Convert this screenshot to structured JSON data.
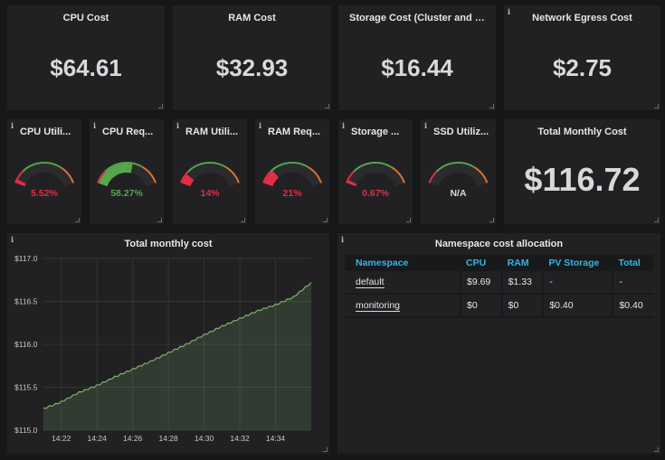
{
  "stats": {
    "cpu_cost": {
      "title": "CPU Cost",
      "value": "$64.61"
    },
    "ram_cost": {
      "title": "RAM Cost",
      "value": "$32.93"
    },
    "storage_cost": {
      "title": "Storage Cost (Cluster and PV...",
      "value": "$16.44"
    },
    "egress_cost": {
      "title": "Network Egress Cost",
      "value": "$2.75"
    },
    "total_monthly": {
      "title": "Total Monthly Cost",
      "value": "$116.72"
    }
  },
  "gauges": [
    {
      "title": "CPU Utili...",
      "value": "5.52%",
      "percent": 5.52,
      "color": "#e02f44",
      "text_color": "#e02f44"
    },
    {
      "title": "CPU Req...",
      "value": "58.27%",
      "percent": 58.27,
      "color": "#56a64b",
      "text_color": "#56a64b"
    },
    {
      "title": "RAM Utili...",
      "value": "14%",
      "percent": 14,
      "color": "#e02f44",
      "text_color": "#e02f44"
    },
    {
      "title": "RAM Req...",
      "value": "21%",
      "percent": 21,
      "color": "#e02f44",
      "text_color": "#e02f44"
    },
    {
      "title": "Storage ...",
      "value": "0.67%",
      "percent": 0.67,
      "color": "#e02f44",
      "text_color": "#e02f44"
    },
    {
      "title": "SSD Utiliz...",
      "value": "N/A",
      "percent": 0,
      "color": "#e02f44",
      "text_color": "#d8d9da"
    }
  ],
  "graph": {
    "title": "Total monthly cost"
  },
  "chart_data": {
    "type": "area",
    "title": "Total monthly cost",
    "ylim": [
      115.0,
      117.0
    ],
    "yticks": [
      "$117.0",
      "$116.5",
      "$116.0",
      "$115.5",
      "$115.0"
    ],
    "xticks": [
      "14:22",
      "14:24",
      "14:26",
      "14:28",
      "14:30",
      "14:32",
      "14:34"
    ],
    "series": [
      {
        "x": [
          "14:21.0",
          "14:22.0",
          "14:23.0",
          "14:24.0",
          "14:25.0",
          "14:26.0",
          "14:27.0",
          "14:28.0",
          "14:29.0",
          "14:30.0",
          "14:31.0",
          "14:32.0",
          "14:33.0",
          "14:34.0",
          "14:35.0",
          "14:36.0"
        ],
        "values": [
          115.25,
          115.33,
          115.44,
          115.52,
          115.62,
          115.71,
          115.8,
          115.9,
          116.0,
          116.11,
          116.21,
          116.3,
          116.39,
          116.46,
          116.55,
          116.72
        ],
        "color": "#7eb26d"
      }
    ]
  },
  "table": {
    "title": "Namespace cost allocation",
    "headers": [
      "Namespace",
      "CPU",
      "RAM",
      "PV Storage",
      "Total"
    ],
    "rows": [
      [
        "default",
        "$9.69",
        "$1.33",
        "-",
        "-"
      ],
      [
        "monitoring",
        "$0",
        "$0",
        "$0.40",
        "$0.40"
      ]
    ]
  },
  "info_icon": "i"
}
